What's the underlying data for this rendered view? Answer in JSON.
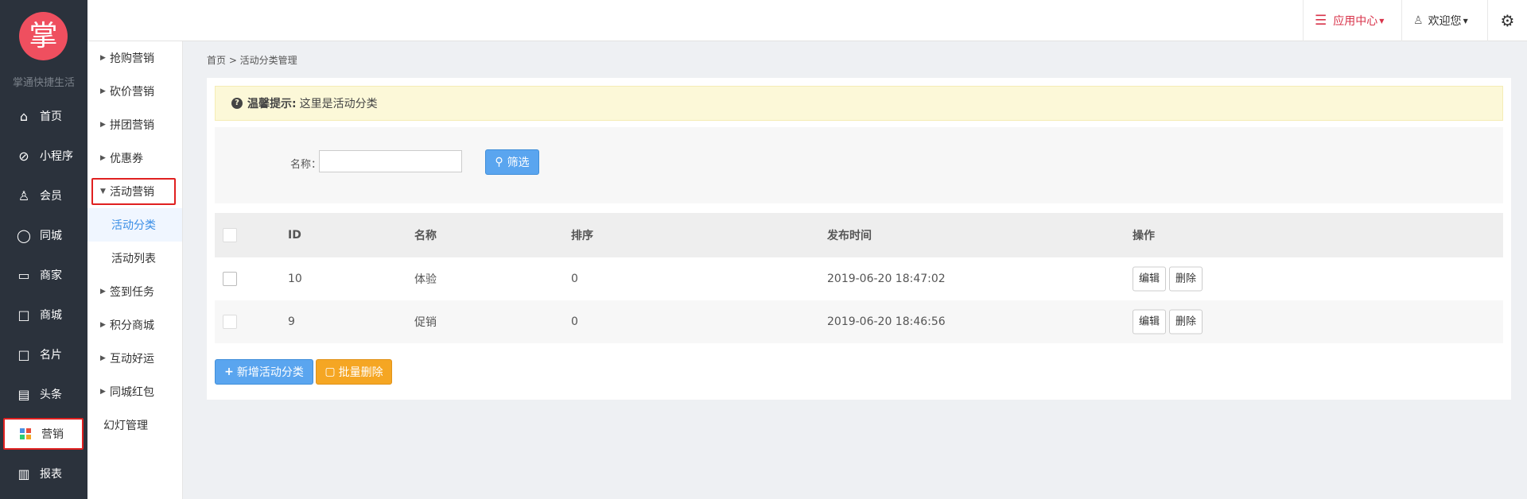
{
  "brand": {
    "logo_char": "掌",
    "name": "掌通快捷生活"
  },
  "nav": [
    {
      "label": "首页",
      "icon": "home-icon",
      "glyph": "⌂"
    },
    {
      "label": "小程序",
      "icon": "miniprogram-icon",
      "glyph": "⊘"
    },
    {
      "label": "会员",
      "icon": "member-icon",
      "glyph": "♙"
    },
    {
      "label": "同城",
      "icon": "city-icon",
      "glyph": "◯"
    },
    {
      "label": "商家",
      "icon": "shop-icon",
      "glyph": "▭"
    },
    {
      "label": "商城",
      "icon": "mall-icon",
      "glyph": "⌂"
    },
    {
      "label": "名片",
      "icon": "card-icon",
      "glyph": "⌂"
    },
    {
      "label": "头条",
      "icon": "news-icon",
      "glyph": "▤"
    },
    {
      "label": "营销",
      "icon": "marketing-icon",
      "glyph": "▦"
    },
    {
      "label": "报表",
      "icon": "report-icon",
      "glyph": "▥"
    }
  ],
  "subnav": [
    {
      "label": "抢购营销"
    },
    {
      "label": "砍价营销"
    },
    {
      "label": "拼团营销"
    },
    {
      "label": "优惠券"
    },
    {
      "label": "活动营销"
    },
    {
      "label": "活动分类"
    },
    {
      "label": "活动列表"
    },
    {
      "label": "签到任务"
    },
    {
      "label": "积分商城"
    },
    {
      "label": "互动好运"
    },
    {
      "label": "同城红包"
    },
    {
      "label": "幻灯管理"
    }
  ],
  "topbar": {
    "app_center": "应用中心",
    "welcome": "欢迎您"
  },
  "breadcrumb": "首页 > 活动分类管理",
  "tip": {
    "title": "温馨提示:",
    "text": "这里是活动分类"
  },
  "filter": {
    "label": "名称：",
    "value": "",
    "button": "筛选"
  },
  "table": {
    "headers": {
      "id": "ID",
      "name": "名称",
      "sort": "排序",
      "time": "发布时间",
      "op": "操作"
    },
    "rows": [
      {
        "id": "10",
        "name": "体验",
        "sort": "0",
        "time": "2019-06-20 18:47:02",
        "edit": "编辑",
        "delete": "删除"
      },
      {
        "id": "9",
        "name": "促销",
        "sort": "0",
        "time": "2019-06-20 18:46:56",
        "edit": "编辑",
        "delete": "删除"
      }
    ]
  },
  "actions": {
    "add": "新增活动分类",
    "batch_delete": "批量删除"
  },
  "colors": {
    "sidebar": "#2b323c",
    "logo": "#ef4f5f",
    "primary": "#5aa5ef",
    "warning": "#f5a623",
    "highlight": "#e02020"
  }
}
